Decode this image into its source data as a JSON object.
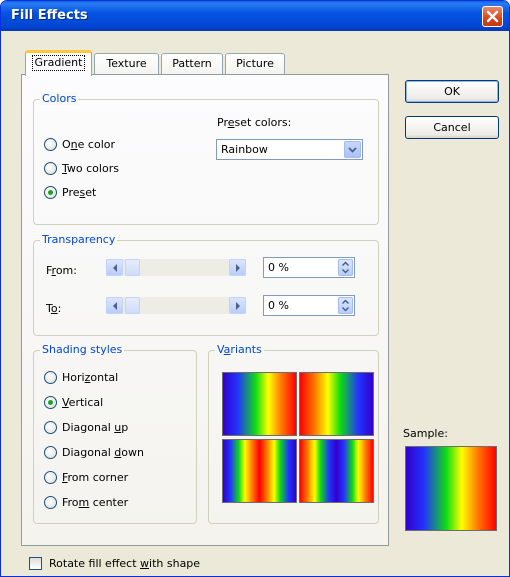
{
  "window": {
    "title": "Fill Effects"
  },
  "tabs": [
    "Gradient",
    "Texture",
    "Pattern",
    "Picture"
  ],
  "colors_group": {
    "legend": "Colors",
    "options": [
      "One color",
      "Two colors",
      "Preset"
    ],
    "selected": "Preset",
    "preset_label": "Preset colors:",
    "preset_value": "Rainbow"
  },
  "transparency": {
    "legend": "Transparency",
    "from_label": "From:",
    "to_label": "To:",
    "from_value": "0 %",
    "to_value": "0 %",
    "from_level": 0,
    "to_level": 0
  },
  "shading": {
    "legend": "Shading styles",
    "options": [
      "Horizontal",
      "Vertical",
      "Diagonal up",
      "Diagonal down",
      "From corner",
      "From center"
    ],
    "selected": "Vertical"
  },
  "variants": {
    "legend": "Variants"
  },
  "buttons": {
    "ok": "OK",
    "cancel": "Cancel"
  },
  "sample": {
    "label": "Sample:"
  },
  "rotate_checkbox": {
    "label": "Rotate fill effect with shape",
    "checked": false
  },
  "colors": {
    "accent_blue": "#0046d5",
    "title_bar": "#0553e3",
    "radio_dot": "#21a121"
  }
}
